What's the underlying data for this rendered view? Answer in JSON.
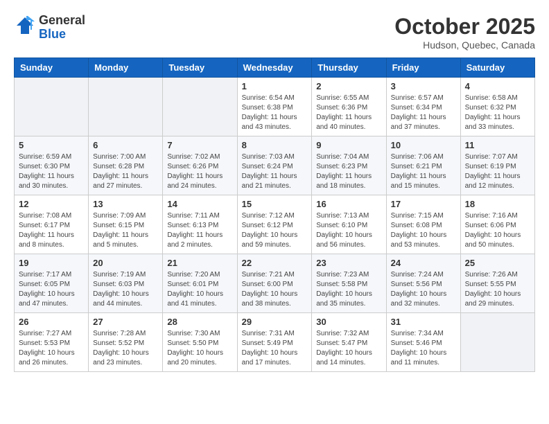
{
  "header": {
    "logo_general": "General",
    "logo_blue": "Blue",
    "month": "October 2025",
    "location": "Hudson, Quebec, Canada"
  },
  "days_of_week": [
    "Sunday",
    "Monday",
    "Tuesday",
    "Wednesday",
    "Thursday",
    "Friday",
    "Saturday"
  ],
  "weeks": [
    [
      {
        "day": "",
        "info": ""
      },
      {
        "day": "",
        "info": ""
      },
      {
        "day": "",
        "info": ""
      },
      {
        "day": "1",
        "info": "Sunrise: 6:54 AM\nSunset: 6:38 PM\nDaylight: 11 hours\nand 43 minutes."
      },
      {
        "day": "2",
        "info": "Sunrise: 6:55 AM\nSunset: 6:36 PM\nDaylight: 11 hours\nand 40 minutes."
      },
      {
        "day": "3",
        "info": "Sunrise: 6:57 AM\nSunset: 6:34 PM\nDaylight: 11 hours\nand 37 minutes."
      },
      {
        "day": "4",
        "info": "Sunrise: 6:58 AM\nSunset: 6:32 PM\nDaylight: 11 hours\nand 33 minutes."
      }
    ],
    [
      {
        "day": "5",
        "info": "Sunrise: 6:59 AM\nSunset: 6:30 PM\nDaylight: 11 hours\nand 30 minutes."
      },
      {
        "day": "6",
        "info": "Sunrise: 7:00 AM\nSunset: 6:28 PM\nDaylight: 11 hours\nand 27 minutes."
      },
      {
        "day": "7",
        "info": "Sunrise: 7:02 AM\nSunset: 6:26 PM\nDaylight: 11 hours\nand 24 minutes."
      },
      {
        "day": "8",
        "info": "Sunrise: 7:03 AM\nSunset: 6:24 PM\nDaylight: 11 hours\nand 21 minutes."
      },
      {
        "day": "9",
        "info": "Sunrise: 7:04 AM\nSunset: 6:23 PM\nDaylight: 11 hours\nand 18 minutes."
      },
      {
        "day": "10",
        "info": "Sunrise: 7:06 AM\nSunset: 6:21 PM\nDaylight: 11 hours\nand 15 minutes."
      },
      {
        "day": "11",
        "info": "Sunrise: 7:07 AM\nSunset: 6:19 PM\nDaylight: 11 hours\nand 12 minutes."
      }
    ],
    [
      {
        "day": "12",
        "info": "Sunrise: 7:08 AM\nSunset: 6:17 PM\nDaylight: 11 hours\nand 8 minutes."
      },
      {
        "day": "13",
        "info": "Sunrise: 7:09 AM\nSunset: 6:15 PM\nDaylight: 11 hours\nand 5 minutes."
      },
      {
        "day": "14",
        "info": "Sunrise: 7:11 AM\nSunset: 6:13 PM\nDaylight: 11 hours\nand 2 minutes."
      },
      {
        "day": "15",
        "info": "Sunrise: 7:12 AM\nSunset: 6:12 PM\nDaylight: 10 hours\nand 59 minutes."
      },
      {
        "day": "16",
        "info": "Sunrise: 7:13 AM\nSunset: 6:10 PM\nDaylight: 10 hours\nand 56 minutes."
      },
      {
        "day": "17",
        "info": "Sunrise: 7:15 AM\nSunset: 6:08 PM\nDaylight: 10 hours\nand 53 minutes."
      },
      {
        "day": "18",
        "info": "Sunrise: 7:16 AM\nSunset: 6:06 PM\nDaylight: 10 hours\nand 50 minutes."
      }
    ],
    [
      {
        "day": "19",
        "info": "Sunrise: 7:17 AM\nSunset: 6:05 PM\nDaylight: 10 hours\nand 47 minutes."
      },
      {
        "day": "20",
        "info": "Sunrise: 7:19 AM\nSunset: 6:03 PM\nDaylight: 10 hours\nand 44 minutes."
      },
      {
        "day": "21",
        "info": "Sunrise: 7:20 AM\nSunset: 6:01 PM\nDaylight: 10 hours\nand 41 minutes."
      },
      {
        "day": "22",
        "info": "Sunrise: 7:21 AM\nSunset: 6:00 PM\nDaylight: 10 hours\nand 38 minutes."
      },
      {
        "day": "23",
        "info": "Sunrise: 7:23 AM\nSunset: 5:58 PM\nDaylight: 10 hours\nand 35 minutes."
      },
      {
        "day": "24",
        "info": "Sunrise: 7:24 AM\nSunset: 5:56 PM\nDaylight: 10 hours\nand 32 minutes."
      },
      {
        "day": "25",
        "info": "Sunrise: 7:26 AM\nSunset: 5:55 PM\nDaylight: 10 hours\nand 29 minutes."
      }
    ],
    [
      {
        "day": "26",
        "info": "Sunrise: 7:27 AM\nSunset: 5:53 PM\nDaylight: 10 hours\nand 26 minutes."
      },
      {
        "day": "27",
        "info": "Sunrise: 7:28 AM\nSunset: 5:52 PM\nDaylight: 10 hours\nand 23 minutes."
      },
      {
        "day": "28",
        "info": "Sunrise: 7:30 AM\nSunset: 5:50 PM\nDaylight: 10 hours\nand 20 minutes."
      },
      {
        "day": "29",
        "info": "Sunrise: 7:31 AM\nSunset: 5:49 PM\nDaylight: 10 hours\nand 17 minutes."
      },
      {
        "day": "30",
        "info": "Sunrise: 7:32 AM\nSunset: 5:47 PM\nDaylight: 10 hours\nand 14 minutes."
      },
      {
        "day": "31",
        "info": "Sunrise: 7:34 AM\nSunset: 5:46 PM\nDaylight: 10 hours\nand 11 minutes."
      },
      {
        "day": "",
        "info": ""
      }
    ]
  ]
}
